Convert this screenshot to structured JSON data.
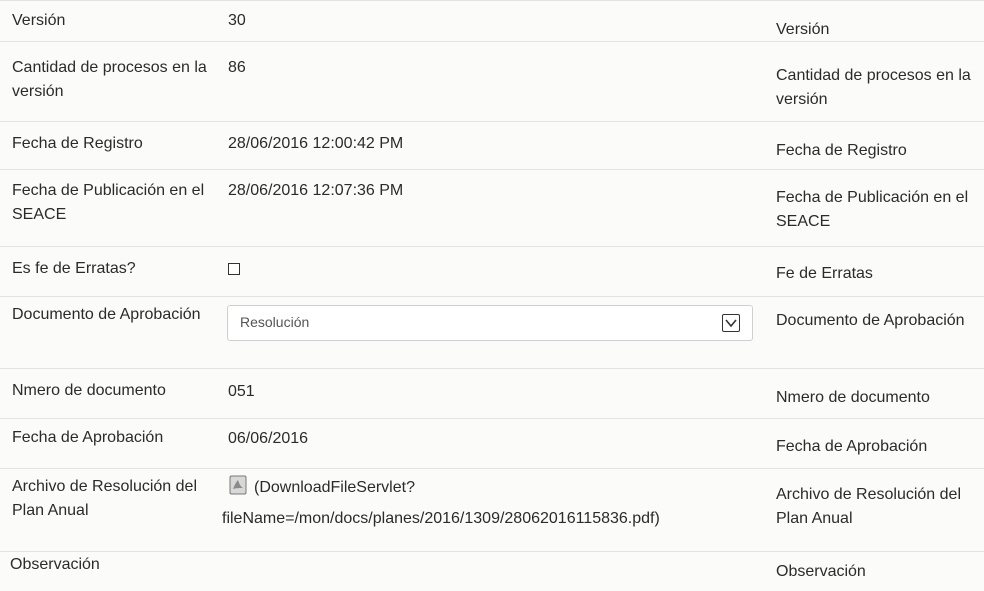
{
  "rows": {
    "version": {
      "label": "Versión",
      "value": "30",
      "label_right": "Versión"
    },
    "cantidad": {
      "label": "Cantidad de procesos en la versión",
      "value": "86",
      "label_right": "Cantidad de procesos en la versión"
    },
    "fecha_registro": {
      "label": "Fecha de Registro",
      "value": "28/06/2016 12:00:42 PM",
      "label_right": "Fecha de Registro"
    },
    "fecha_publicacion": {
      "label": "Fecha de Publicación en el SEACE",
      "value": "28/06/2016 12:07:36 PM",
      "label_right": "Fecha de Publicación en el SEACE"
    },
    "fe_erratas": {
      "label": "Es fe de Erratas?",
      "checked": false,
      "label_right": "Fe de Erratas"
    },
    "documento": {
      "label": "Documento de Aprobación",
      "selected": "Resolución",
      "label_right": "Documento de Aprobación"
    },
    "numero": {
      "label": "Nmero de documento",
      "value": "051",
      "label_right": "Nmero de documento"
    },
    "fecha_aprobacion": {
      "label": "Fecha de Aprobación",
      "value": "06/06/2016",
      "label_right": "Fecha de Aprobación"
    },
    "archivo": {
      "label": "Archivo de Resolución del Plan Anual",
      "link_line1": "(DownloadFileServlet?",
      "link_line2": "fileName=/mon/docs/planes/2016/1309/28062016115836.pdf)",
      "icon": "pdf-file-icon",
      "label_right": "Archivo de Resolución del Plan Anual"
    },
    "observacion": {
      "label": "Observación",
      "value": "",
      "label_right": "Observación"
    }
  }
}
